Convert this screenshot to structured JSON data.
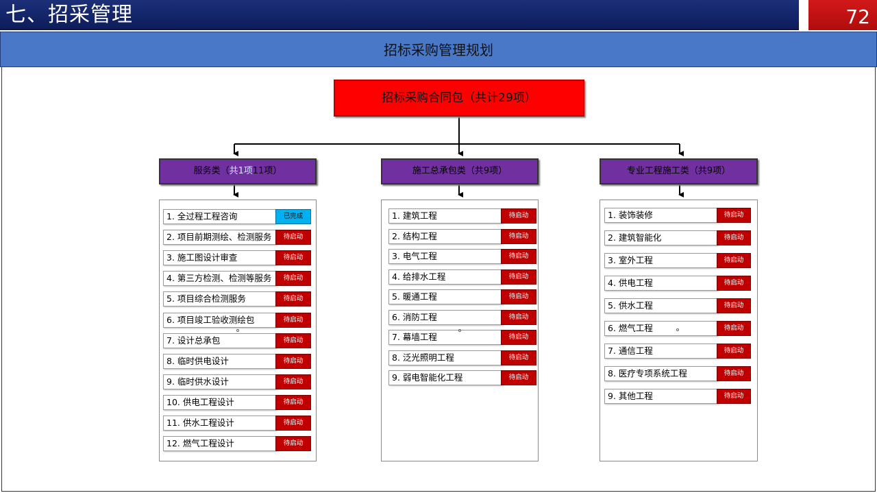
{
  "header": {
    "title": "七、招采管理",
    "page_number": "72"
  },
  "subheader": {
    "title": "招标采购管理规划"
  },
  "root": {
    "label": "招标采购合同包（共计29项）"
  },
  "categories": [
    {
      "label_pre": "服务类（",
      "label_hl": "共1项",
      "label_post": "11项）",
      "items": [
        {
          "label": "1. 全过程工程咨询",
          "status": "已完成",
          "done": true
        },
        {
          "label": "2. 项目前期测绘、检测服务",
          "status": "待启动"
        },
        {
          "label": "3. 施工图设计审查",
          "status": "待启动"
        },
        {
          "label": "4. 第三方检测、检测等服务",
          "status": "待启动"
        },
        {
          "label": "5. 项目综合检测服务",
          "status": "待启动"
        },
        {
          "label": "6. 项目竣工验收测绘包",
          "status": "待启动"
        },
        {
          "label": "7. 设计总承包",
          "status": "待启动"
        },
        {
          "label": "8. 临时供电设计",
          "status": "待启动"
        },
        {
          "label": "9. 临时供水设计",
          "status": "待启动"
        },
        {
          "label": "10. 供电工程设计",
          "status": "待启动"
        },
        {
          "label": "11. 供水工程设计",
          "status": "待启动"
        },
        {
          "label": "12. 燃气工程设计",
          "status": "待启动"
        }
      ]
    },
    {
      "label": "施工总承包类（共9项）",
      "items": [
        {
          "label": "1. 建筑工程",
          "status": "待启动"
        },
        {
          "label": "2. 结构工程",
          "status": "待启动"
        },
        {
          "label": "3. 电气工程",
          "status": "待启动"
        },
        {
          "label": "4. 给排水工程",
          "status": "待启动"
        },
        {
          "label": "5. 暖通工程",
          "status": "待启动"
        },
        {
          "label": "6. 消防工程",
          "status": "待启动"
        },
        {
          "label": "7. 幕墙工程",
          "status": "待启动"
        },
        {
          "label": "8. 泛光照明工程",
          "status": "待启动"
        },
        {
          "label": "9. 弱电智能化工程",
          "status": "待启动"
        }
      ]
    },
    {
      "label": "专业工程施工类（共9项）",
      "items": [
        {
          "label": "1. 装饰装修",
          "status": "待启动"
        },
        {
          "label": "2. 建筑智能化",
          "status": "待启动"
        },
        {
          "label": "3. 室外工程",
          "status": "待启动"
        },
        {
          "label": "4. 供电工程",
          "status": "待启动"
        },
        {
          "label": "5. 供水工程",
          "status": "待启动"
        },
        {
          "label": "6. 燃气工程",
          "status": "待启动"
        },
        {
          "label": "7. 通信工程",
          "status": "待启动"
        },
        {
          "label": "8. 医疗专项系统工程",
          "status": "待启动"
        },
        {
          "label": "9. 其他工程",
          "status": "待启动"
        }
      ]
    }
  ],
  "colors": {
    "header_bg": "#0d1d5c",
    "subheader_bg": "#4a78c8",
    "root_bg": "#ff0000",
    "category_bg": "#7030a0",
    "pending": "#c00000",
    "done": "#00b0f0"
  }
}
